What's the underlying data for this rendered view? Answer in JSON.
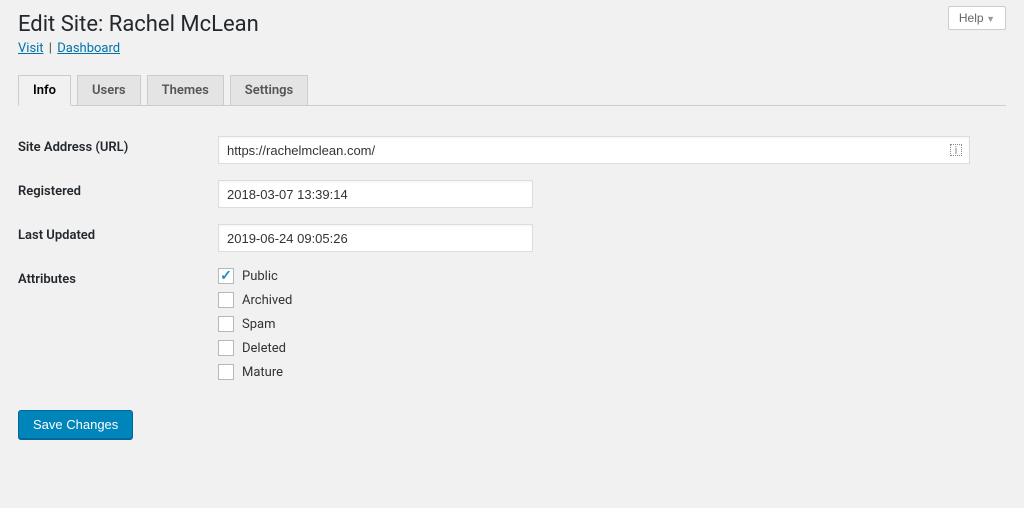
{
  "help_label": "Help",
  "page_title": "Edit Site: Rachel McLean",
  "sublinks": {
    "visit": "Visit",
    "dashboard": "Dashboard"
  },
  "tabs": [
    {
      "label": "Info",
      "active": true
    },
    {
      "label": "Users",
      "active": false
    },
    {
      "label": "Themes",
      "active": false
    },
    {
      "label": "Settings",
      "active": false
    }
  ],
  "fields": {
    "url_label": "Site Address (URL)",
    "url_value": "https://rachelmclean.com/",
    "registered_label": "Registered",
    "registered_value": "2018-03-07 13:39:14",
    "updated_label": "Last Updated",
    "updated_value": "2019-06-24 09:05:26",
    "attributes_label": "Attributes"
  },
  "attributes": [
    {
      "label": "Public",
      "checked": true
    },
    {
      "label": "Archived",
      "checked": false
    },
    {
      "label": "Spam",
      "checked": false
    },
    {
      "label": "Deleted",
      "checked": false
    },
    {
      "label": "Mature",
      "checked": false
    }
  ],
  "save_label": "Save Changes"
}
